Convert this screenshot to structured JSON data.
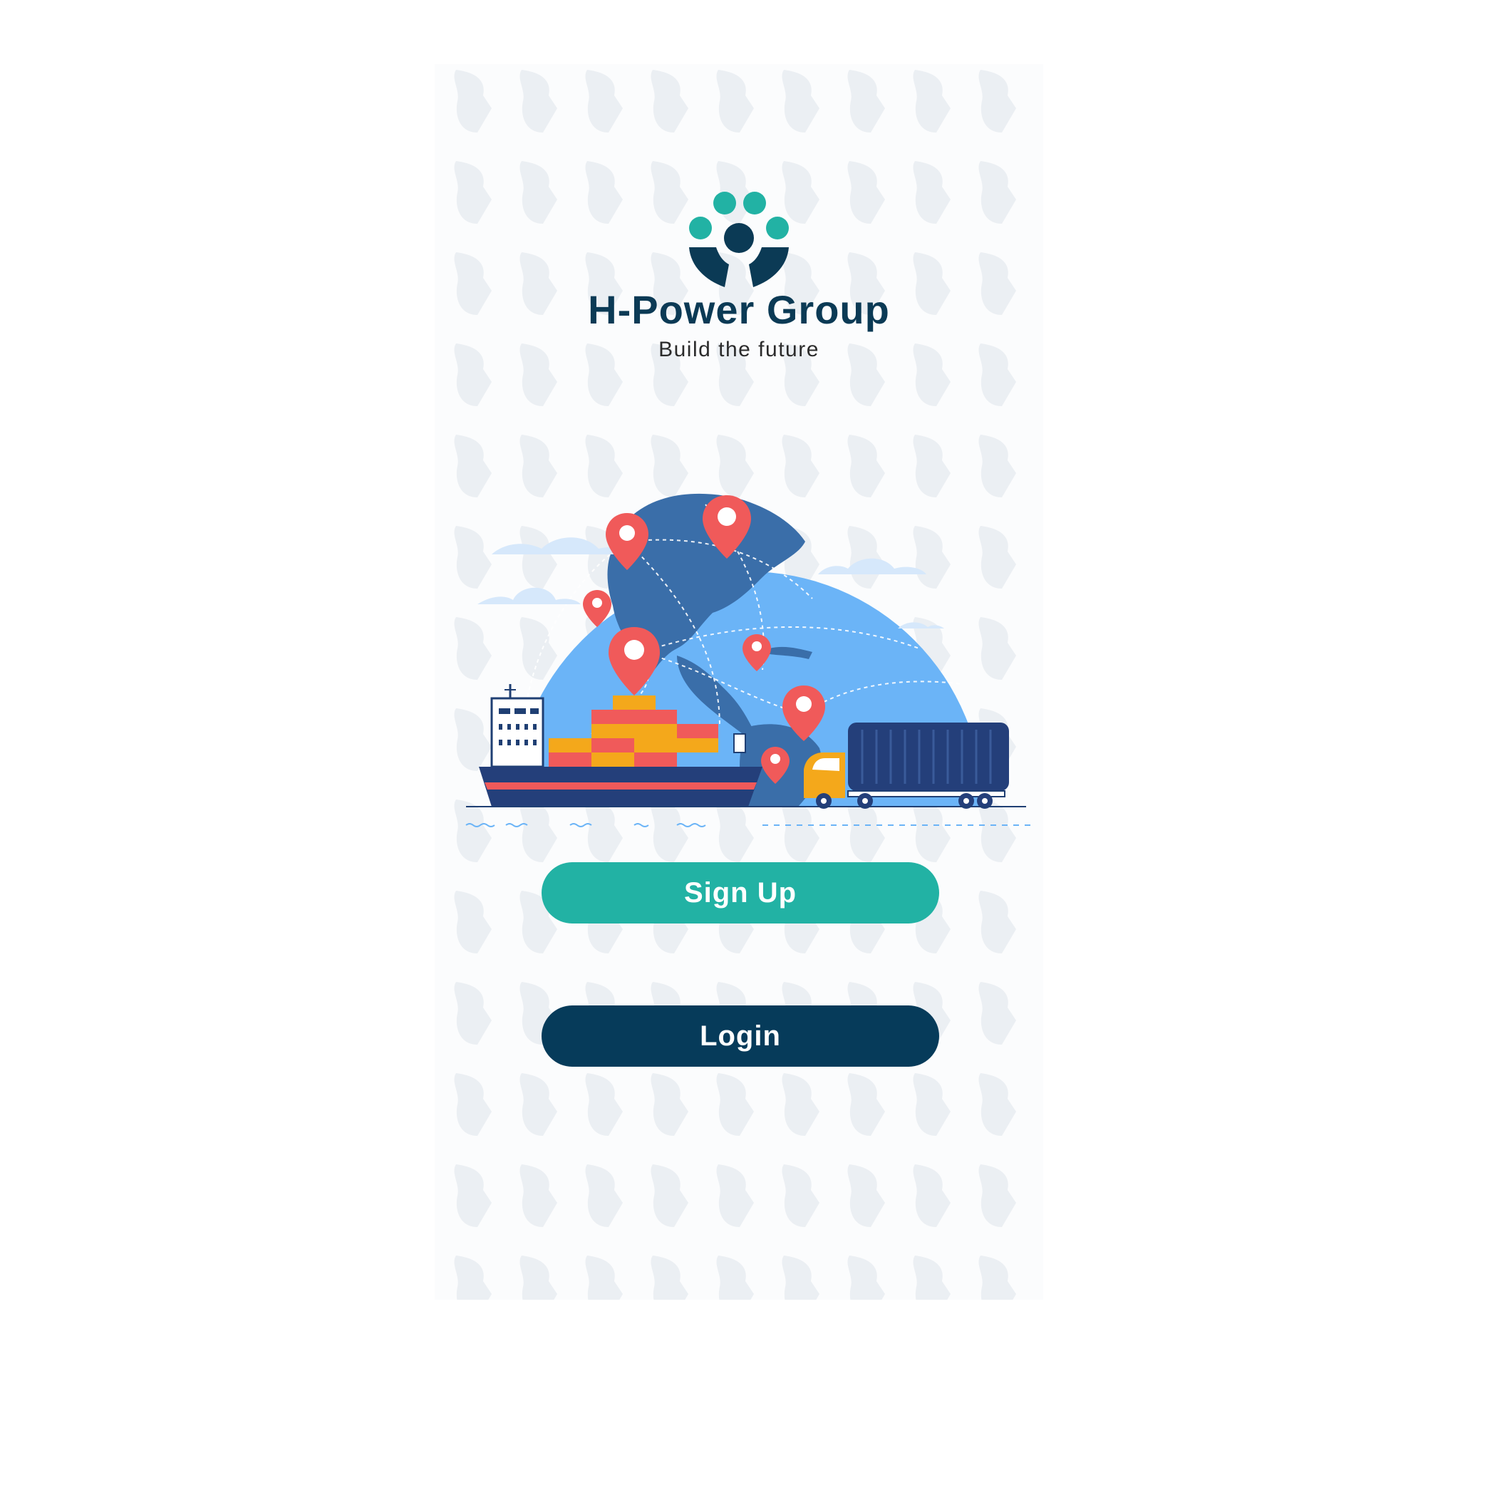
{
  "brand": {
    "name": "H-Power Group",
    "tagline": "Build the future"
  },
  "actions": {
    "signup_label": "Sign Up",
    "login_label": "Login"
  },
  "colors": {
    "primary_teal": "#22b2a4",
    "primary_navy": "#063b5a",
    "brand_text": "#0b3a55"
  },
  "illustration": {
    "subject": "globe-logistics-illustration"
  }
}
